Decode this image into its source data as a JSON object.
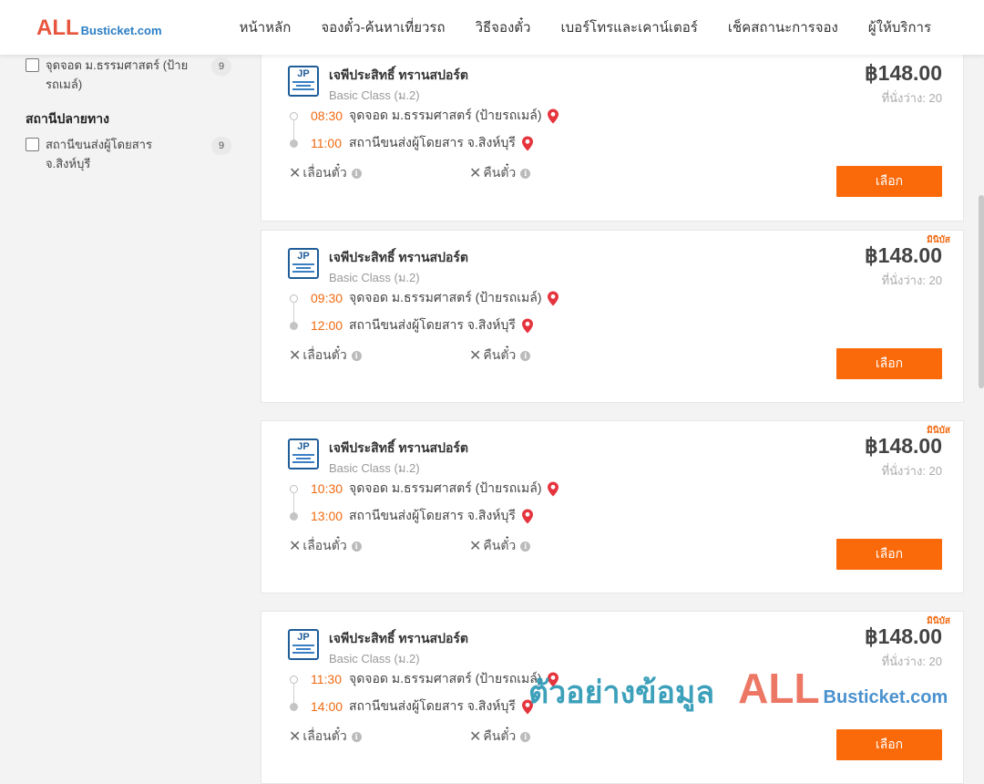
{
  "header": {
    "logo_all": "ALL",
    "logo_rest": "Busticket.com",
    "nav": [
      "หน้าหลัก",
      "จองตั๋ว-ค้นหาเที่ยวรถ",
      "วิธีจองตั๋ว",
      "เบอร์โทรและเคาน์เตอร์",
      "เช็คสถานะการจอง",
      "ผู้ให้บริการ"
    ]
  },
  "sidebar": {
    "boarding_filter": {
      "label": "จุดจอด ม.ธรรมศาสตร์ (ป้ายรถเมล์)",
      "count": "9"
    },
    "destination_heading": "สถานีปลายทาง",
    "destination_filter": {
      "label": "สถานีขนส่งผู้โดยสาร จ.สิงห์บุรี",
      "count": "9"
    }
  },
  "trips": [
    {
      "operator": "เจพีประสิทธิ์ ทรานสปอร์ต",
      "bus_class": "Basic Class (ม.2)",
      "price": "฿148.00",
      "seats": "ที่นั่งว่าง: 20",
      "tag": "",
      "depart_time": "08:30",
      "depart_place": "จุดจอด ม.ธรรมศาสตร์ (ป้ายรถเมล์)",
      "arrive_time": "11:00",
      "arrive_place": "สถานีขนส่งผู้โดยสาร จ.สิงห์บุรี",
      "reschedule": "เลื่อนตั๋ว",
      "refund": "คืนตั๋ว",
      "button": "เลือก"
    },
    {
      "operator": "เจพีประสิทธิ์ ทรานสปอร์ต",
      "bus_class": "Basic Class (ม.2)",
      "price": "฿148.00",
      "seats": "ที่นั่งว่าง: 20",
      "tag": "มินิบัส",
      "depart_time": "09:30",
      "depart_place": "จุดจอด ม.ธรรมศาสตร์ (ป้ายรถเมล์)",
      "arrive_time": "12:00",
      "arrive_place": "สถานีขนส่งผู้โดยสาร จ.สิงห์บุรี",
      "reschedule": "เลื่อนตั๋ว",
      "refund": "คืนตั๋ว",
      "button": "เลือก"
    },
    {
      "operator": "เจพีประสิทธิ์ ทรานสปอร์ต",
      "bus_class": "Basic Class (ม.2)",
      "price": "฿148.00",
      "seats": "ที่นั่งว่าง: 20",
      "tag": "มินิบัส",
      "depart_time": "10:30",
      "depart_place": "จุดจอด ม.ธรรมศาสตร์ (ป้ายรถเมล์)",
      "arrive_time": "13:00",
      "arrive_place": "สถานีขนส่งผู้โดยสาร จ.สิงห์บุรี",
      "reschedule": "เลื่อนตั๋ว",
      "refund": "คืนตั๋ว",
      "button": "เลือก"
    },
    {
      "operator": "เจพีประสิทธิ์ ทรานสปอร์ต",
      "bus_class": "Basic Class (ม.2)",
      "price": "฿148.00",
      "seats": "ที่นั่งว่าง: 20",
      "tag": "มินิบัส",
      "depart_time": "11:30",
      "depart_place": "จุดจอด ม.ธรรมศาสตร์ (ป้ายรถเมล์)",
      "arrive_time": "14:00",
      "arrive_place": "สถานีขนส่งผู้โดยสาร จ.สิงห์บุรี",
      "reschedule": "เลื่อนตั๋ว",
      "refund": "คืนตั๋ว",
      "button": "เลือก"
    }
  ],
  "watermark": {
    "thai": "ตัวอย่างข้อมูล",
    "all": "ALL",
    "rest": "Busticket.com"
  },
  "colors": {
    "accent": "#fa6a0a",
    "time": "#f06a12",
    "brand_red": "#e8553e",
    "brand_blue": "#2a7ec5",
    "pin": "#e5343d"
  }
}
